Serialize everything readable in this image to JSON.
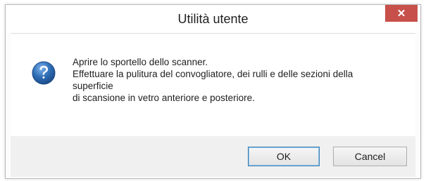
{
  "window": {
    "title": "Utilità utente",
    "close_glyph": "✕"
  },
  "message": {
    "icon": "question-icon",
    "lines": [
      "Aprire lo sportello dello scanner.",
      "Effettuare la pulitura del convogliatore, dei rulli e delle sezioni della",
      "superficie",
      "di scansione in vetro anteriore e posteriore."
    ]
  },
  "buttons": {
    "ok_label": "OK",
    "cancel_label": "Cancel"
  },
  "colors": {
    "close_button": "#c7504a",
    "icon_blue": "#2f6fb6",
    "footer": "#f0f0f0"
  }
}
